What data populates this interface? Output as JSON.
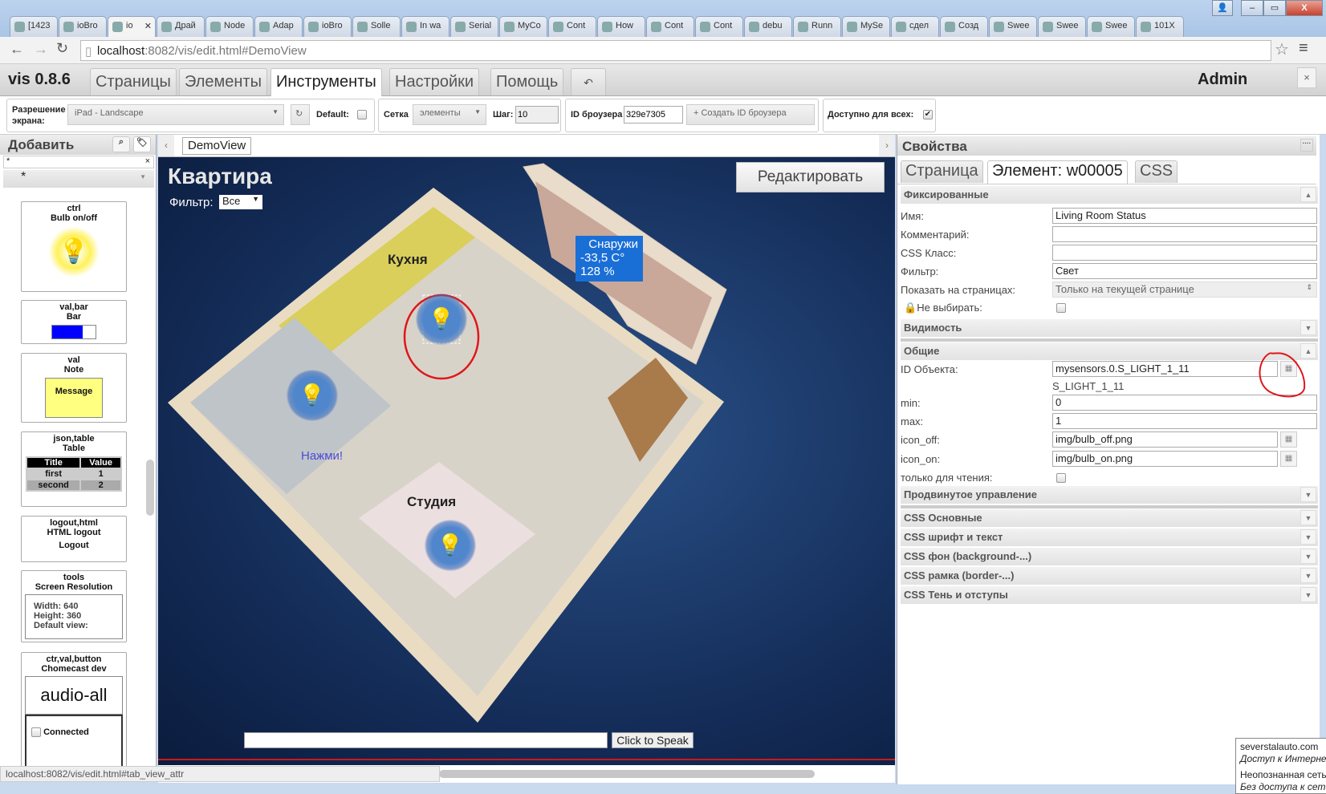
{
  "browser": {
    "tabs": [
      "[1423",
      "ioBro",
      "io",
      "Драй",
      "Node",
      "Adap",
      "ioBro",
      "Solle",
      "In wa",
      "Serial",
      "MyCo",
      "Cont",
      "How",
      "Cont",
      "Cont",
      "debu",
      "Runn",
      "MySe",
      "сдел",
      "Созд",
      "Swee",
      "Swee",
      "Swee",
      "101X"
    ],
    "active_tab_index": 2,
    "url_host": "localhost",
    "url_rest": ":8082/vis/edit.html#DemoView",
    "status_url": "localhost:8082/vis/edit.html#tab_view_attr"
  },
  "app": {
    "title": "vis 0.8.6",
    "tabs": [
      "Страницы",
      "Элементы",
      "Инструменты",
      "Настройки",
      "Помощь"
    ],
    "active_tab": "Инструменты",
    "undo_icon": "↶",
    "user": "Admin",
    "close": "×"
  },
  "toolbar": {
    "resolution_label": "Разрешение экрана:",
    "resolution_value": "iPad - Landscape",
    "default_label": "Default:",
    "grid_label": "Сетка",
    "grid_value": "элементы",
    "step_label": "Шаг:",
    "step_value": "10",
    "browser_id_label": "ID броузера",
    "browser_id_value": "329e7305",
    "create_browser_id": "+ Создать ID броузера",
    "available_all_label": "Доступно для всех:",
    "available_all_checked": true
  },
  "left_panel": {
    "title": "Добавить",
    "filter_value": "*",
    "set_value": "*",
    "widgets": [
      {
        "set": "ctrl",
        "name": "Bulb on/off"
      },
      {
        "set": "val,bar",
        "name": "Bar",
        "fill_percent": 70
      },
      {
        "set": "val",
        "name": "Note",
        "text": "Message"
      },
      {
        "set": "json,table",
        "name": "Table",
        "headers": [
          "Title",
          "Value"
        ],
        "rows": [
          [
            "first",
            "1"
          ],
          [
            "second",
            "2"
          ]
        ]
      },
      {
        "set": "logout,html",
        "name": "HTML logout",
        "text": "Logout"
      },
      {
        "set": "tools",
        "name": "Screen Resolution",
        "lines": [
          "Width: 640",
          "Height: 360",
          "Default view:"
        ]
      },
      {
        "set": "ctr,val,button",
        "name": "Chomecast dev",
        "text": "audio-all",
        "checkbox_label": "Connected"
      }
    ]
  },
  "view": {
    "tab": "DemoView",
    "title": "Квартира",
    "filter_label": "Фильтр:",
    "filter_value": "Все",
    "edit_button": "Редактировать",
    "rooms": [
      "Кухня",
      "Студия"
    ],
    "press_label": "Нажми!",
    "outside": {
      "title": "Снаружи",
      "temp": "-33,5 C°",
      "humidity": "128 %"
    },
    "speak_button": "Click to Speak"
  },
  "properties": {
    "title": "Свойства",
    "tabs": [
      "Страница",
      "Элемент: w00005",
      "CSS"
    ],
    "active_tab": "Элемент: w00005",
    "sections": {
      "fixed": "Фиксированные",
      "visibility": "Видимость",
      "common": "Общие",
      "advanced": "Продвинутое управление",
      "css_basic": "CSS Основные",
      "css_font": "CSS шрифт и текст",
      "css_bg": "CSS фон (background-...)",
      "css_border": "CSS рамка (border-...)",
      "css_shadow": "CSS Тень и отступы"
    },
    "fields": {
      "name_label": "Имя:",
      "name_value": "Living Room Status",
      "comment_label": "Комментарий:",
      "comment_value": "",
      "class_label": "CSS Класс:",
      "class_value": "",
      "filter_label": "Фильтр:",
      "filter_value": "Свет",
      "pages_label": "Показать на страницах:",
      "pages_value": "Только на текущей странице",
      "noselect_label": "Не выбирать:",
      "oid_label": "ID Объекта:",
      "oid_value": "mysensors.0.S_LIGHT_1_11",
      "oid_name": "S_LIGHT_1_11",
      "min_label": "min:",
      "min_value": "0",
      "max_label": "max:",
      "max_value": "1",
      "icon_off_label": "icon_off:",
      "icon_off_value": "img/bulb_off.png",
      "icon_on_label": "icon_on:",
      "icon_on_value": "img/bulb_on.png",
      "readonly_label": "только для чтения:"
    }
  },
  "tooltip": {
    "line1": "severstalauto.com",
    "line2": "Доступ к Интернету",
    "line3": "Неопознанная сеть",
    "line4": "Без доступа к сети"
  },
  "colors": {
    "accent_blue": "#1a6fd6",
    "annotation_red": "#e0161b",
    "bulb_blue": "#4f86cc"
  }
}
